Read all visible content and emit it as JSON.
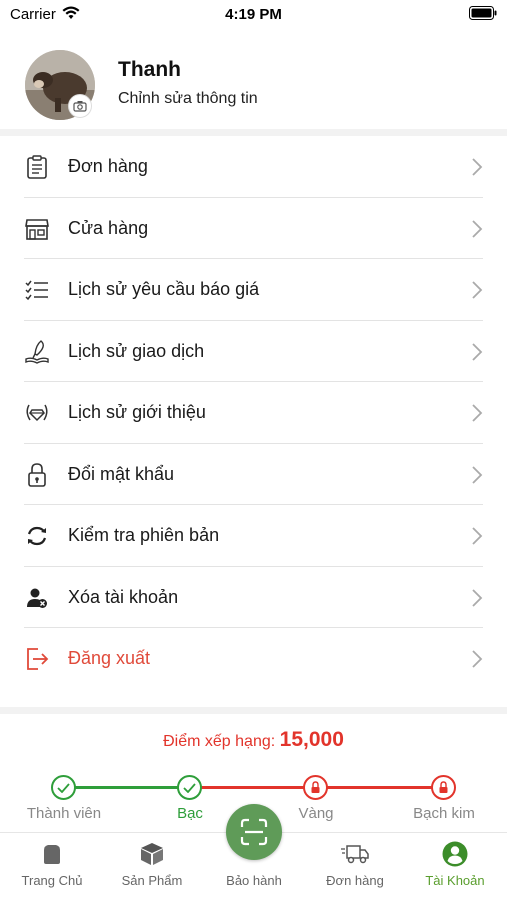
{
  "status_bar": {
    "carrier": "Carrier",
    "time": "4:19 PM"
  },
  "profile": {
    "name": "Thanh",
    "edit_label": "Chỉnh sửa thông tin"
  },
  "menu": {
    "items": [
      {
        "label": "Đơn hàng",
        "icon": "clipboard-icon"
      },
      {
        "label": "Cửa hàng",
        "icon": "store-icon"
      },
      {
        "label": "Lịch sử yêu cầu báo giá",
        "icon": "checklist-icon"
      },
      {
        "label": "Lịch sử giao dịch",
        "icon": "quill-book-icon"
      },
      {
        "label": "Lịch sử giới thiệu",
        "icon": "laurel-diamond-icon"
      },
      {
        "label": "Đổi mật khẩu",
        "icon": "lock-icon"
      },
      {
        "label": "Kiểm tra phiên bản",
        "icon": "refresh-icon"
      },
      {
        "label": "Xóa tài khoản",
        "icon": "delete-user-icon"
      },
      {
        "label": "Đăng xuất",
        "icon": "logout-icon"
      }
    ]
  },
  "rank": {
    "label": "Điểm xếp hạng:",
    "value": "15,000",
    "tiers": [
      {
        "label": "Thành viên",
        "status": "done"
      },
      {
        "label": "Bạc",
        "status": "done"
      },
      {
        "label": "Vàng",
        "status": "locked"
      },
      {
        "label": "Bạch kim",
        "status": "locked"
      }
    ]
  },
  "tabbar": {
    "tabs": [
      {
        "label": "Trang Chủ",
        "icon": "home-icon"
      },
      {
        "label": "Sản Phẩm",
        "icon": "box-icon"
      },
      {
        "label": "Bảo hành",
        "icon": "scan-icon"
      },
      {
        "label": "Đơn hàng",
        "icon": "delivery-truck-icon"
      },
      {
        "label": "Tài Khoản",
        "icon": "account-icon"
      }
    ],
    "active": "Tài Khoản"
  },
  "colors": {
    "green": "#2e9e3a",
    "red": "#e2342b",
    "tab_active": "#5a9e2e",
    "scan_button": "#5f9b58"
  }
}
